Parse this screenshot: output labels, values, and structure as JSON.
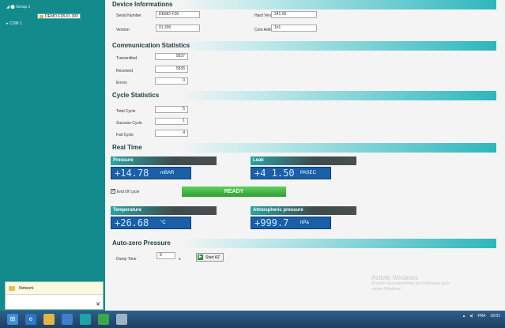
{
  "sidebar": {
    "tree": [
      "◢ ⬤ Group 1",
      "DEMO F28-01.300",
      "▸ COM 1"
    ],
    "network_label": "Network",
    "collapse_glyph": "¥"
  },
  "device": {
    "header": "Device Informations",
    "serial_number_label": "Serial Number",
    "serial_number_value": "DEMO F28",
    "hard_version_label": "Hard Version",
    "hard_version_value": "341.05",
    "version_label": "Version",
    "version_value": "01.300",
    "com_address_label": "Com Address",
    "com_address_value": "1h1"
  },
  "communication": {
    "header": "Communication Statistics",
    "transmitted_label": "Transmitted",
    "transmitted_value": "5837",
    "received_label": "Received",
    "received_value": "5836",
    "errors_label": "Errors",
    "errors_value": "0"
  },
  "cycle": {
    "header": "Cycle Statistics",
    "total_label": "Total Cycle",
    "total_value": "5",
    "success_label": "Success Cycle",
    "success_value": "1",
    "fail_label": "Fail Cycle",
    "fail_value": "4"
  },
  "realtime": {
    "header": "Real Time",
    "pressure_label": "Pressure",
    "pressure_value": "+14.78",
    "pressure_unit": "mBAR",
    "leak_label": "Leak",
    "leak_value": "+4 1.50",
    "leak_unit": "PASEC",
    "end_of_cycle_label": "End Of cycle",
    "end_of_cycle_checked": true,
    "ready_label": "READY",
    "temperature_label": "Temperature",
    "temperature_value": "+26.68",
    "temperature_unit": "°C",
    "atm_label": "Atmospheric pressure",
    "atm_value": "+999.7",
    "atm_unit": "hPa"
  },
  "autozero": {
    "header": "Auto-zero Pressure",
    "dump_time_label": "Dump Time",
    "dump_time_value": "8",
    "dump_time_unit": "s",
    "start_button_label": "Start AZ"
  },
  "watermark": {
    "title": "Activer Windows",
    "line1": "Accéder aux paramètres de l'ordinateur pour",
    "line2": "activer Windows."
  },
  "taskbar": {
    "icons": [
      "windows-start",
      "internet-explorer",
      "file-explorer",
      "app-blue",
      "app-teal",
      "app-green",
      "app-chart"
    ],
    "tray_language": "FRA",
    "tray_time": "16:01",
    "colors": {
      "accent": "#2cb7bc",
      "sidebar": "#138a8c",
      "display": "#1a5fa8",
      "ready": "#3bb13f"
    }
  }
}
